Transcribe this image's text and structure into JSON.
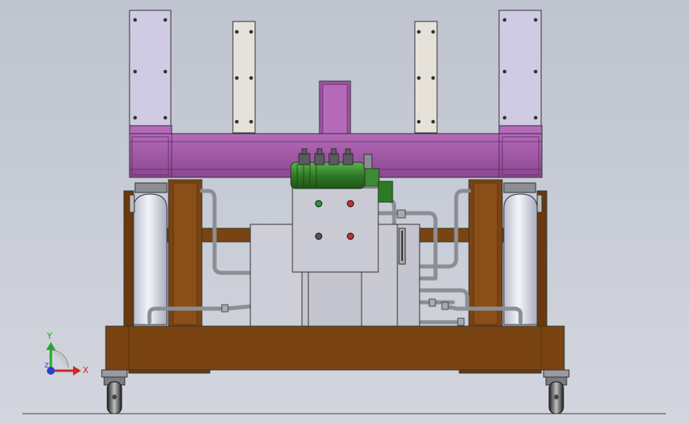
{
  "viewport": {
    "background_top": "#bfc4d0",
    "background_bottom": "#d3d6de"
  },
  "colors": {
    "frame_purple": "#a055a6",
    "frame_purple_dark": "#7a3a80",
    "plate_lilac": "#cfcbe3",
    "plate_cream": "#e6e1d9",
    "wood_brown": "#7a4412",
    "wood_brown_dark": "#5a300b",
    "tank_white": "#eef0f8",
    "panel_grey": "#c8c9d3",
    "pipe_grey": "#8d8e94",
    "motor_green": "#3e8a35",
    "button_green": "#2c9a3a",
    "button_red": "#c43030",
    "button_grey": "#555555",
    "axis_x": "#d12626",
    "axis_y": "#26a62c",
    "axis_z": "#2a3fcc"
  },
  "triad": {
    "x_label": "X",
    "y_label": "Y",
    "z_label": "Z"
  },
  "control_panel": {
    "indicators": [
      "green-light",
      "red-light",
      "grey-button",
      "red-button"
    ]
  }
}
